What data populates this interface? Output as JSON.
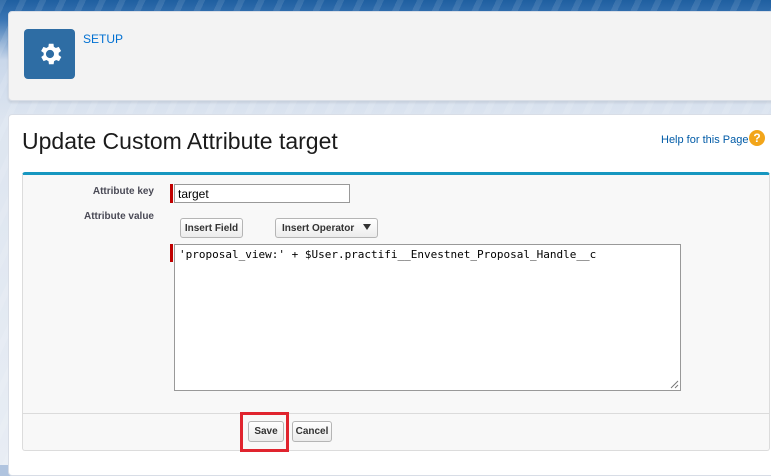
{
  "header": {
    "setup_label": "SETUP",
    "tile_icon": "gear-icon",
    "tile_color": "#2e6da4"
  },
  "page": {
    "title": "Update Custom Attribute target",
    "help_link": "Help for this Page",
    "help_icon": "question-icon"
  },
  "form": {
    "attribute_key_label": "Attribute key",
    "attribute_key_value": "target",
    "attribute_value_label": "Attribute value",
    "insert_field_label": "Insert Field",
    "insert_operator_label": "Insert Operator",
    "formula_value": "'proposal_view:' + $User.practifi__Envestnet_Proposal_Handle__c",
    "required_color": "#c00000"
  },
  "actions": {
    "save_label": "Save",
    "cancel_label": "Cancel",
    "highlight_color": "#e0242e"
  }
}
